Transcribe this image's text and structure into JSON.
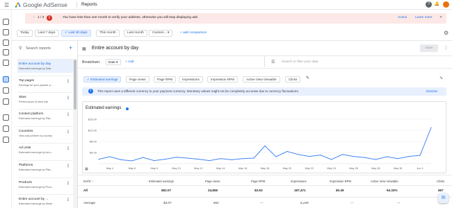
{
  "app": {
    "brand": "Google AdSense",
    "page_title": "Reports"
  },
  "banner": {
    "pager": "1 / 3",
    "message": "You have less than one month to verify your address, otherwise you will stop displaying ads.",
    "action": "Action",
    "learn_more": "Learn more"
  },
  "date_ranges": [
    "Today",
    "Last 7 days",
    "Last 30 days",
    "This month",
    "Last month",
    "Custom..."
  ],
  "selected_range": "Last 30 days",
  "add_comparison": "+ add comparison",
  "sidebar": {
    "search_label": "Search reports",
    "items": [
      {
        "title": "Entire account by day",
        "subtitle": "Estimated earnings by Date"
      },
      {
        "title": "Top pages",
        "subtitle": "Earnings for your popular p..."
      },
      {
        "title": "Sites",
        "subtitle": "Performance of each site"
      },
      {
        "title": "Content platform",
        "subtitle": "Estimated earnings by Plat..."
      },
      {
        "title": "Countries",
        "subtitle": "View ads perform by country"
      },
      {
        "title": "Ad units",
        "subtitle": "Estimated earnings by Ad u..."
      },
      {
        "title": "Platforms",
        "subtitle": "Estimated earnings by Plat..."
      },
      {
        "title": "Products",
        "subtitle": "Estimated earnings by Prod..."
      },
      {
        "title": "Entire account by ...",
        "subtitle": "Estimated earnings by Week"
      }
    ]
  },
  "report": {
    "title": "Entire account by day",
    "save": "Save",
    "breakdown_label": "Breakdown:",
    "breakdown_value": "Date",
    "add": "Add",
    "filter_placeholder": "Search or filter your data",
    "metric_tabs": [
      "Estimated earnings",
      "Page views",
      "Page RPM",
      "Impressions",
      "Impression RPM",
      "Active View Viewable",
      "Clicks"
    ],
    "info": "This report uses a different currency to your payment currency. Monetary values might not be completely accurate due to currency fluctuations.",
    "dismiss": "Dismiss",
    "chart_title": "Estimated earnings"
  },
  "chart_data": {
    "type": "line",
    "title": "Estimated earnings",
    "y_ticks": [
      "$16.00",
      "$12.00",
      "$8.00",
      "$4.00"
    ],
    "ylim": [
      0,
      17
    ],
    "x_labels": [
      "May 4",
      "May 6",
      "May 8",
      "May 10",
      "May 12",
      "May 14",
      "May 16",
      "May 18",
      "May 20",
      "May 22",
      "May 24",
      "May 26",
      "May 28",
      "May 30",
      "Jun 1"
    ],
    "x": [
      "May 3",
      "May 4",
      "May 5",
      "May 6",
      "May 7",
      "May 8",
      "May 9",
      "May 10",
      "May 11",
      "May 12",
      "May 13",
      "May 14",
      "May 15",
      "May 16",
      "May 17",
      "May 18",
      "May 19",
      "May 20",
      "May 21",
      "May 22",
      "May 23",
      "May 24",
      "May 25",
      "May 26",
      "May 27",
      "May 28",
      "May 29",
      "May 30",
      "May 31",
      "Jun 1",
      "Jun 2"
    ],
    "values": [
      1.6,
      2.5,
      1.4,
      1.0,
      2.2,
      1.1,
      1.6,
      2.3,
      2.0,
      1.6,
      1.1,
      1.8,
      1.4,
      1.8,
      2.0,
      6.4,
      2.5,
      4.4,
      3.3,
      2.6,
      3.1,
      1.5,
      3.3,
      2.6,
      2.2,
      1.5,
      2.5,
      1.8,
      2.6,
      3.0,
      13.0
    ],
    "grid": true
  },
  "table": {
    "columns": [
      "DATE",
      "Estimated earnings",
      "Page views",
      "Page RPM",
      "Impressions",
      "Impression RPM",
      "Active View Viewable",
      "Clicks"
    ],
    "all": [
      "All",
      "$92.07",
      "24,855",
      "$3.63",
      "187,471",
      "$0.49",
      "54.33%",
      "567"
    ],
    "average": [
      "Average",
      "$3.07",
      "851",
      "—",
      "6,249",
      "—",
      "—",
      ""
    ]
  },
  "colors": {
    "accent": "#1a73e8",
    "banner_bg": "#fce8e6",
    "warn": "#d93025"
  }
}
